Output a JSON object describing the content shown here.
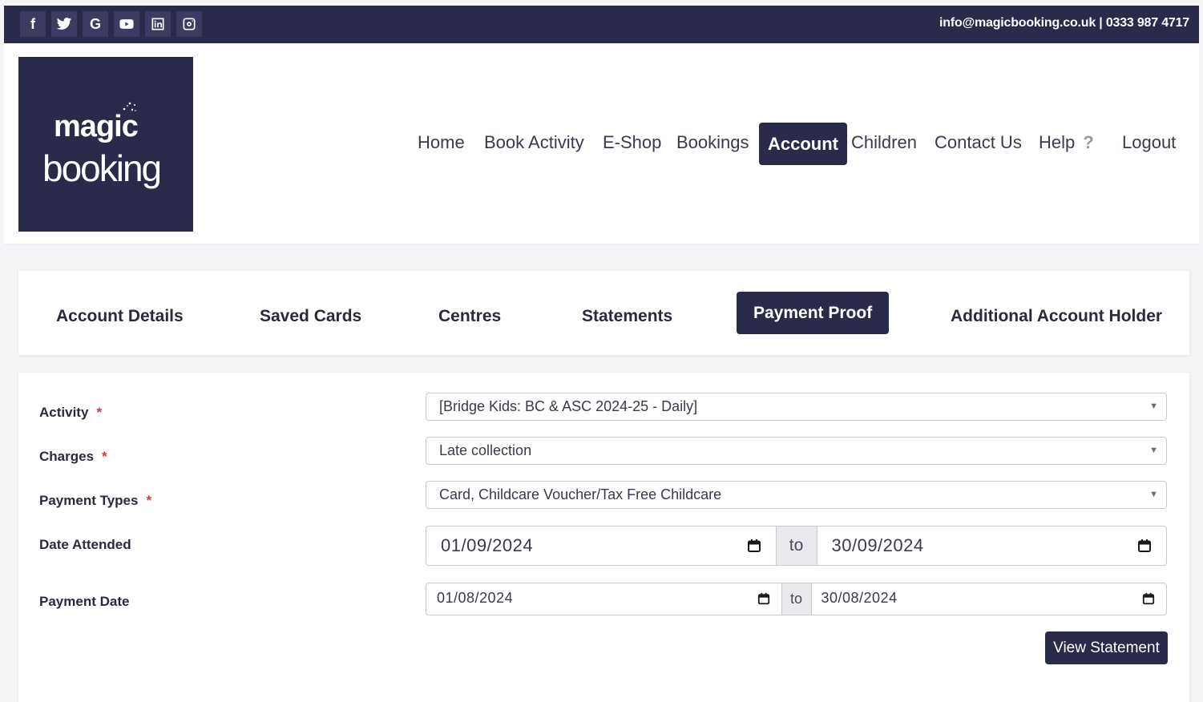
{
  "topbar": {
    "socials": [
      {
        "name": "facebook-icon",
        "glyph": "f"
      },
      {
        "name": "twitter-icon",
        "glyph": ""
      },
      {
        "name": "google-icon",
        "glyph": "G"
      },
      {
        "name": "youtube-icon",
        "glyph": ""
      },
      {
        "name": "linkedin-icon",
        "glyph": ""
      },
      {
        "name": "instagram-icon",
        "glyph": ""
      }
    ],
    "contact": "info@magicbooking.co.uk | 0333 987 4717"
  },
  "logo": {
    "line1": "magic",
    "line2": "booking"
  },
  "nav": {
    "home": "Home",
    "book_activity": "Book Activity",
    "eshop": "E-Shop",
    "bookings": "Bookings",
    "account": "Account",
    "children": "Children",
    "contact_us": "Contact Us",
    "help": "Help",
    "help_icon": "?",
    "logout": "Logout"
  },
  "tabs": {
    "account_details": "Account Details",
    "saved_cards": "Saved Cards",
    "centres": "Centres",
    "statements": "Statements",
    "payment_proof": "Payment Proof",
    "additional_holder": "Additional Account Holder"
  },
  "form": {
    "activity_label": "Activity",
    "activity_value": "[Bridge Kids: BC & ASC 2024-25 - Daily]",
    "charges_label": "Charges",
    "charges_value": "Late collection",
    "payment_types_label": "Payment Types",
    "payment_types_value": "Card, Childcare Voucher/Tax Free Childcare",
    "required_mark": "*",
    "date_attended_label": "Date Attended",
    "date_attended_from": "01/09/2024",
    "date_attended_to": "30/09/2024",
    "payment_date_label": "Payment Date",
    "payment_date_from": "01/08/2024",
    "payment_date_to": "30/08/2024",
    "to_label": "to",
    "caret": "▼",
    "view_statement": "View Statement"
  },
  "colors": {
    "brand_navy": "#2a2a4a",
    "required_red": "#e0343c"
  }
}
